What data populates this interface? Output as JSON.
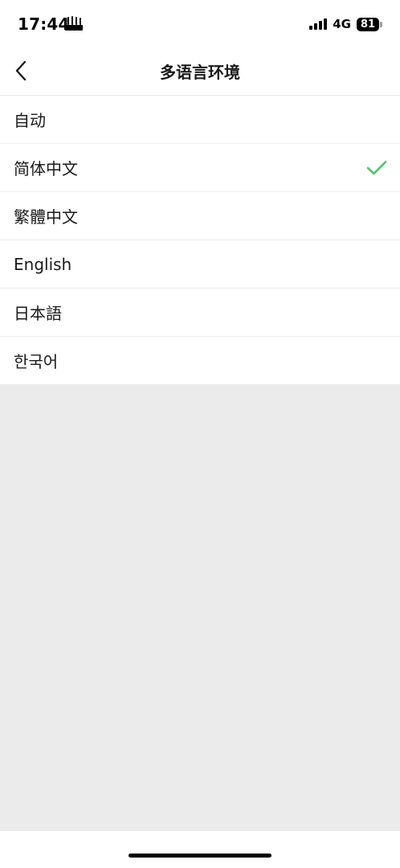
{
  "status_bar": {
    "time": "17:44",
    "network": "4G",
    "battery": "81"
  },
  "nav": {
    "title": "多语言环境"
  },
  "languages": [
    {
      "label": "自动",
      "selected": false
    },
    {
      "label": "简体中文",
      "selected": true
    },
    {
      "label": "繁體中文",
      "selected": false
    },
    {
      "label": "English",
      "selected": false
    },
    {
      "label": "日本語",
      "selected": false
    },
    {
      "label": "한국어",
      "selected": false
    }
  ],
  "colors": {
    "check": "#4cc764",
    "background": "#ebebeb",
    "surface": "#ffffff"
  },
  "icons": {
    "back": "chevron-left-icon",
    "check": "check-icon",
    "signal": "cellular-signal-icon",
    "battery": "battery-icon"
  }
}
